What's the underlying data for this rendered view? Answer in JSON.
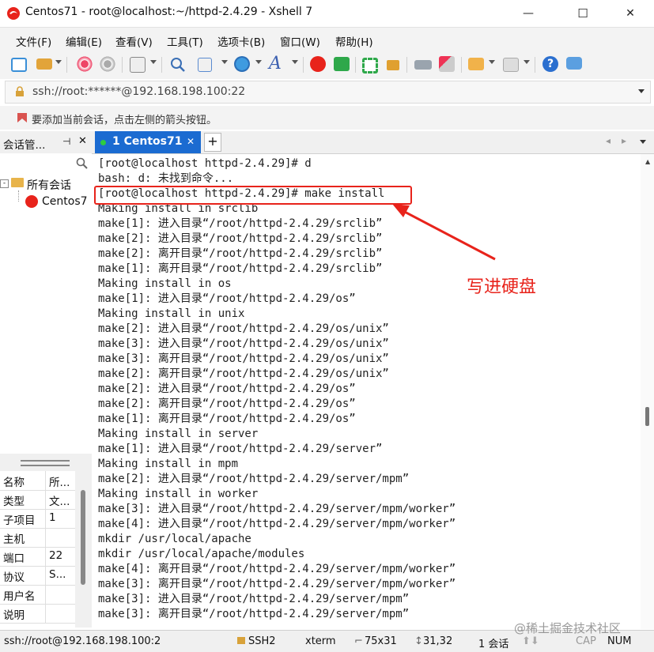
{
  "window": {
    "title": "Centos71 - root@localhost:~/httpd-2.4.29 - Xshell 7",
    "buttons": {
      "minimize": "—",
      "maximize": "☐",
      "close": "✕"
    }
  },
  "menu": [
    "文件(F)",
    "编辑(E)",
    "查看(V)",
    "工具(T)",
    "选项卡(B)",
    "窗口(W)",
    "帮助(H)"
  ],
  "address": {
    "value": "ssh://root:******@192.168.198.100:22"
  },
  "hint": "要添加当前会话，点击左侧的箭头按钮。",
  "sessions": {
    "header": "会话管...",
    "tree_root": "所有会话",
    "tree_child": "Centos7"
  },
  "properties": [
    {
      "k": "名称",
      "v": "所..."
    },
    {
      "k": "类型",
      "v": "文..."
    },
    {
      "k": "子项目",
      "v": "1"
    },
    {
      "k": "主机",
      "v": ""
    },
    {
      "k": "端口",
      "v": "22"
    },
    {
      "k": "协议",
      "v": "S..."
    },
    {
      "k": "用户名",
      "v": ""
    },
    {
      "k": "说明",
      "v": ""
    }
  ],
  "tab": {
    "label": "1 Centos71",
    "close": "✕"
  },
  "terminal_lines": [
    "[root@localhost httpd-2.4.29]# d",
    "bash: d: 未找到命令...",
    "[root@localhost httpd-2.4.29]# make install",
    "Making install in srclib",
    "make[1]: 进入目录“/root/httpd-2.4.29/srclib”",
    "make[2]: 进入目录“/root/httpd-2.4.29/srclib”",
    "make[2]: 离开目录“/root/httpd-2.4.29/srclib”",
    "make[1]: 离开目录“/root/httpd-2.4.29/srclib”",
    "Making install in os",
    "make[1]: 进入目录“/root/httpd-2.4.29/os”",
    "Making install in unix",
    "make[2]: 进入目录“/root/httpd-2.4.29/os/unix”",
    "make[3]: 进入目录“/root/httpd-2.4.29/os/unix”",
    "make[3]: 离开目录“/root/httpd-2.4.29/os/unix”",
    "make[2]: 离开目录“/root/httpd-2.4.29/os/unix”",
    "make[2]: 进入目录“/root/httpd-2.4.29/os”",
    "make[2]: 离开目录“/root/httpd-2.4.29/os”",
    "make[1]: 离开目录“/root/httpd-2.4.29/os”",
    "Making install in server",
    "make[1]: 进入目录“/root/httpd-2.4.29/server”",
    "Making install in mpm",
    "make[2]: 进入目录“/root/httpd-2.4.29/server/mpm”",
    "Making install in worker",
    "make[3]: 进入目录“/root/httpd-2.4.29/server/mpm/worker”",
    "make[4]: 进入目录“/root/httpd-2.4.29/server/mpm/worker”",
    "mkdir /usr/local/apache",
    "mkdir /usr/local/apache/modules",
    "make[4]: 离开目录“/root/httpd-2.4.29/server/mpm/worker”",
    "make[3]: 离开目录“/root/httpd-2.4.29/server/mpm/worker”",
    "make[3]: 进入目录“/root/httpd-2.4.29/server/mpm”",
    "make[3]: 离开目录“/root/httpd-2.4.29/server/mpm”"
  ],
  "annotation": {
    "text": "写进硬盘",
    "color": "#e8231b"
  },
  "status": {
    "connection": "ssh://root@192.168.198.100:2",
    "protocol": "SSH2",
    "term": "xterm",
    "size": "75x31",
    "cursor": "31,32",
    "sessions": "1 会话",
    "caps": "CAP",
    "num": "NUM"
  },
  "watermark": "@稀土掘金技术社区",
  "colors": {
    "tab_active": "#1b6bd1",
    "accent_red": "#e8231b"
  }
}
